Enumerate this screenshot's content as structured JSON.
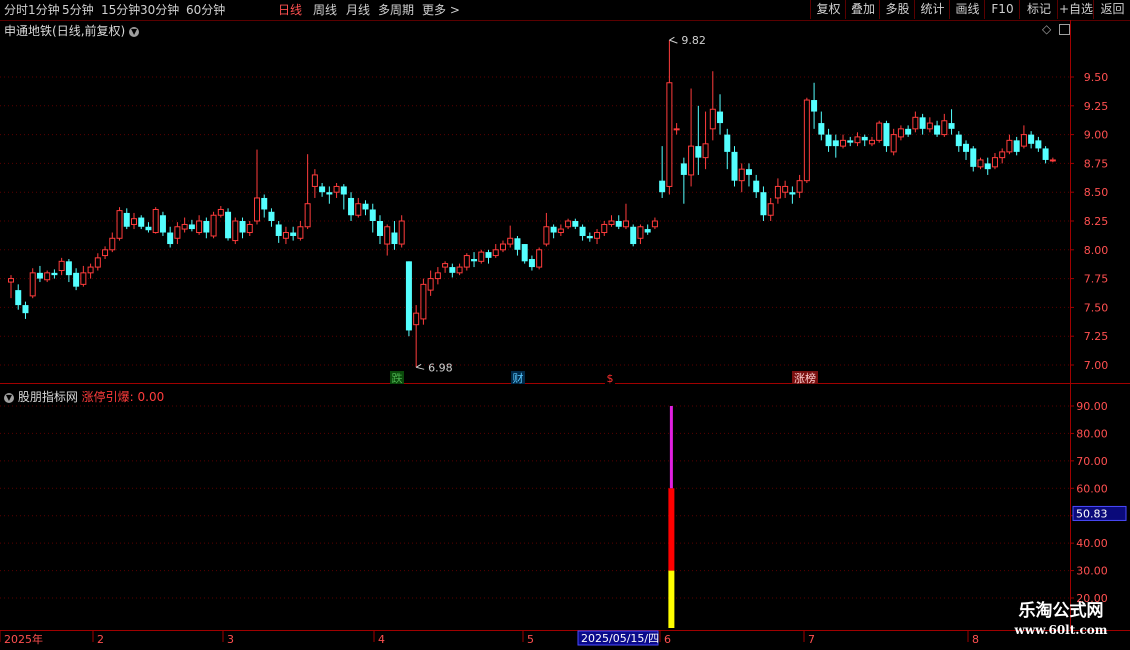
{
  "toolbar": {
    "left_items": [
      "分时",
      "1分钟",
      "5分钟",
      "15分钟",
      "30分钟",
      "60分钟",
      "日线",
      "周线",
      "月线",
      "多周期",
      "更多 >"
    ],
    "active_index": 6,
    "right_items": [
      "复权",
      "叠加",
      "多股",
      "统计",
      "画线",
      "F10",
      "标记",
      "+自选",
      "返回"
    ]
  },
  "main_chart": {
    "stock_name": "申通地铁",
    "period_label": "(日线,前复权)",
    "high_label": "9.82",
    "low_label": "6.98",
    "y_ticks": [
      "9.50",
      "9.25",
      "9.00",
      "8.75",
      "8.50",
      "8.25",
      "8.00",
      "7.75",
      "7.50",
      "7.25",
      "7.00"
    ],
    "markers": [
      {
        "text": "跌",
        "color": "#4caf50",
        "bg": "#0a4a0a"
      },
      {
        "text": "财",
        "color": "#5ac8ff",
        "bg": "#002a4a"
      },
      {
        "text": "$",
        "color": "#ff3030",
        "bg": "#000000"
      },
      {
        "text": "涨榜",
        "color": "#ffd0d0",
        "bg": "#7a1010"
      }
    ]
  },
  "indicator": {
    "name": "股朋指标网",
    "label": "涨停引爆:",
    "value": "0.00",
    "y_ticks": [
      "90.00",
      "80.00",
      "70.00",
      "60.00",
      "50.00",
      "40.00",
      "30.00",
      "20.00"
    ],
    "cursor_value": "50.83",
    "bar": {
      "total": 90,
      "segments": [
        {
          "from": 0,
          "to": 30,
          "color": "#ffff00"
        },
        {
          "from": 30,
          "to": 60,
          "color": "#ff0000"
        },
        {
          "from": 60,
          "to": 90,
          "color": "#e020e0"
        }
      ]
    }
  },
  "time_axis": {
    "labels": [
      "2025年",
      "2",
      "3",
      "4",
      "5",
      "6",
      "7",
      "8"
    ],
    "cursor_date": "2025/05/15/四"
  },
  "watermark": {
    "line1": "乐淘公式网",
    "line2": "www.60lt.com"
  },
  "colors": {
    "up": "#ff3c3c",
    "down": "#54ffff",
    "axis": "#a00000",
    "grid": "#5a0000",
    "tick_text": "#ff5050"
  },
  "chart_data": {
    "type": "candlestick",
    "title": "申通地铁(日线,前复权)",
    "ylim": [
      6.9,
      9.9
    ],
    "candles": [
      [
        7.72,
        7.75,
        7.78,
        7.58
      ],
      [
        7.65,
        7.52,
        7.7,
        7.48
      ],
      [
        7.52,
        7.45,
        7.55,
        7.4
      ],
      [
        7.6,
        7.8,
        7.84,
        7.58
      ],
      [
        7.8,
        7.75,
        7.86,
        7.72
      ],
      [
        7.74,
        7.8,
        7.82,
        7.72
      ],
      [
        7.8,
        7.78,
        7.83,
        7.75
      ],
      [
        7.82,
        7.9,
        7.93,
        7.78
      ],
      [
        7.9,
        7.78,
        7.92,
        7.72
      ],
      [
        7.8,
        7.68,
        7.84,
        7.65
      ],
      [
        7.7,
        7.8,
        7.86,
        7.68
      ],
      [
        7.8,
        7.85,
        7.88,
        7.75
      ],
      [
        7.85,
        7.93,
        7.97,
        7.82
      ],
      [
        7.95,
        8.0,
        8.03,
        7.92
      ],
      [
        8.0,
        8.1,
        8.15,
        7.98
      ],
      [
        8.1,
        8.34,
        8.37,
        8.08
      ],
      [
        8.32,
        8.2,
        8.36,
        8.18
      ],
      [
        8.22,
        8.27,
        8.32,
        8.18
      ],
      [
        8.28,
        8.2,
        8.3,
        8.18
      ],
      [
        8.2,
        8.17,
        8.24,
        8.15
      ],
      [
        8.15,
        8.35,
        8.37,
        8.14
      ],
      [
        8.3,
        8.15,
        8.33,
        8.12
      ],
      [
        8.15,
        8.05,
        8.2,
        8.02
      ],
      [
        8.1,
        8.2,
        8.24,
        8.05
      ],
      [
        8.18,
        8.22,
        8.28,
        8.15
      ],
      [
        8.22,
        8.18,
        8.26,
        8.16
      ],
      [
        8.15,
        8.25,
        8.3,
        8.13
      ],
      [
        8.25,
        8.15,
        8.28,
        8.1
      ],
      [
        8.12,
        8.3,
        8.33,
        8.1
      ],
      [
        8.3,
        8.35,
        8.38,
        8.28
      ],
      [
        8.33,
        8.1,
        8.36,
        8.08
      ],
      [
        8.08,
        8.25,
        8.28,
        8.05
      ],
      [
        8.25,
        8.15,
        8.28,
        8.1
      ],
      [
        8.15,
        8.22,
        8.25,
        8.12
      ],
      [
        8.25,
        8.45,
        8.87,
        8.22
      ],
      [
        8.45,
        8.35,
        8.48,
        8.28
      ],
      [
        8.33,
        8.25,
        8.36,
        8.2
      ],
      [
        8.22,
        8.12,
        8.25,
        8.06
      ],
      [
        8.1,
        8.15,
        8.2,
        8.05
      ],
      [
        8.15,
        8.12,
        8.2,
        8.08
      ],
      [
        8.1,
        8.2,
        8.25,
        8.08
      ],
      [
        8.2,
        8.4,
        8.83,
        8.18
      ],
      [
        8.55,
        8.65,
        8.7,
        8.45
      ],
      [
        8.55,
        8.5,
        8.58,
        8.46
      ],
      [
        8.5,
        8.48,
        8.55,
        8.4
      ],
      [
        8.5,
        8.55,
        8.58,
        8.45
      ],
      [
        8.55,
        8.48,
        8.57,
        8.35
      ],
      [
        8.45,
        8.3,
        8.5,
        8.25
      ],
      [
        8.3,
        8.4,
        8.45,
        8.28
      ],
      [
        8.4,
        8.35,
        8.43,
        8.3
      ],
      [
        8.35,
        8.25,
        8.4,
        8.15
      ],
      [
        8.25,
        8.12,
        8.3,
        8.05
      ],
      [
        8.05,
        8.2,
        8.22,
        7.95
      ],
      [
        8.15,
        8.05,
        8.25,
        8.0
      ],
      [
        8.05,
        8.25,
        8.3,
        8.02
      ],
      [
        7.9,
        7.3,
        7.9,
        7.25
      ],
      [
        7.35,
        7.45,
        7.52,
        6.98
      ],
      [
        7.4,
        7.7,
        7.75,
        7.35
      ],
      [
        7.65,
        7.75,
        7.82,
        7.6
      ],
      [
        7.75,
        7.8,
        7.85,
        7.7
      ],
      [
        7.85,
        7.88,
        7.9,
        7.8
      ],
      [
        7.85,
        7.8,
        7.88,
        7.76
      ],
      [
        7.8,
        7.85,
        7.88,
        7.78
      ],
      [
        7.85,
        7.95,
        7.97,
        7.82
      ],
      [
        7.92,
        7.9,
        7.98,
        7.85
      ],
      [
        7.9,
        7.98,
        8.0,
        7.88
      ],
      [
        7.98,
        7.93,
        8.0,
        7.88
      ],
      [
        7.95,
        8.0,
        8.05,
        7.93
      ],
      [
        8.0,
        8.05,
        8.08,
        7.98
      ],
      [
        8.05,
        8.1,
        8.21,
        8.02
      ],
      [
        8.1,
        8.0,
        8.12,
        7.95
      ],
      [
        8.05,
        7.9,
        8.05,
        7.88
      ],
      [
        7.92,
        7.85,
        7.95,
        7.82
      ],
      [
        7.85,
        8.0,
        8.02,
        7.83
      ],
      [
        8.05,
        8.2,
        8.32,
        8.03
      ],
      [
        8.2,
        8.15,
        8.22,
        8.1
      ],
      [
        8.15,
        8.18,
        8.22,
        8.12
      ],
      [
        8.2,
        8.25,
        8.27,
        8.18
      ],
      [
        8.25,
        8.2,
        8.27,
        8.18
      ],
      [
        8.2,
        8.12,
        8.22,
        8.08
      ],
      [
        8.12,
        8.1,
        8.15,
        8.07
      ],
      [
        8.1,
        8.15,
        8.18,
        8.05
      ],
      [
        8.15,
        8.22,
        8.25,
        8.12
      ],
      [
        8.22,
        8.25,
        8.3,
        8.2
      ],
      [
        8.25,
        8.2,
        8.3,
        8.18
      ],
      [
        8.2,
        8.25,
        8.4,
        8.18
      ],
      [
        8.2,
        8.05,
        8.22,
        8.03
      ],
      [
        8.1,
        8.2,
        8.22,
        8.05
      ],
      [
        8.18,
        8.15,
        8.22,
        8.13
      ],
      [
        8.2,
        8.25,
        8.28,
        8.18
      ],
      [
        8.6,
        8.5,
        8.9,
        8.45
      ],
      [
        8.55,
        9.45,
        9.82,
        8.48
      ],
      [
        9.05,
        9.05,
        9.1,
        9.0
      ],
      [
        8.75,
        8.65,
        8.8,
        8.4
      ],
      [
        8.65,
        8.9,
        9.4,
        8.55
      ],
      [
        8.9,
        8.8,
        9.25,
        8.65
      ],
      [
        8.8,
        8.92,
        9.2,
        8.7
      ],
      [
        9.05,
        9.22,
        9.55,
        8.95
      ],
      [
        9.2,
        9.1,
        9.35,
        9.0
      ],
      [
        9.0,
        8.85,
        9.05,
        8.7
      ],
      [
        8.85,
        8.6,
        8.9,
        8.55
      ],
      [
        8.6,
        8.7,
        8.75,
        8.5
      ],
      [
        8.7,
        8.65,
        8.75,
        8.55
      ],
      [
        8.6,
        8.5,
        8.65,
        8.45
      ],
      [
        8.5,
        8.3,
        8.55,
        8.25
      ],
      [
        8.3,
        8.4,
        8.45,
        8.25
      ],
      [
        8.45,
        8.55,
        8.62,
        8.4
      ],
      [
        8.5,
        8.55,
        8.6,
        8.45
      ],
      [
        8.5,
        8.48,
        8.55,
        8.4
      ],
      [
        8.5,
        8.6,
        8.65,
        8.45
      ],
      [
        8.6,
        9.3,
        9.32,
        8.58
      ],
      [
        9.3,
        9.2,
        9.45,
        9.05
      ],
      [
        9.1,
        9.0,
        9.2,
        8.95
      ],
      [
        9.0,
        8.9,
        9.05,
        8.85
      ],
      [
        8.95,
        8.9,
        9.0,
        8.8
      ],
      [
        8.9,
        8.95,
        9.0,
        8.88
      ],
      [
        8.95,
        8.93,
        8.98,
        8.9
      ],
      [
        8.93,
        8.98,
        9.02,
        8.9
      ],
      [
        8.98,
        8.95,
        9.0,
        8.9
      ],
      [
        8.92,
        8.95,
        8.98,
        8.9
      ],
      [
        8.95,
        9.1,
        9.12,
        8.93
      ],
      [
        9.1,
        8.9,
        9.12,
        8.85
      ],
      [
        8.85,
        9.0,
        9.05,
        8.82
      ],
      [
        8.98,
        9.05,
        9.08,
        8.95
      ],
      [
        9.05,
        9.0,
        9.08,
        8.98
      ],
      [
        9.05,
        9.15,
        9.2,
        9.02
      ],
      [
        9.15,
        9.05,
        9.18,
        9.0
      ],
      [
        9.05,
        9.1,
        9.15,
        9.02
      ],
      [
        9.08,
        9.0,
        9.12,
        8.98
      ],
      [
        9.0,
        9.12,
        9.18,
        8.98
      ],
      [
        9.1,
        9.05,
        9.22,
        9.0
      ],
      [
        9.0,
        8.9,
        9.03,
        8.85
      ],
      [
        8.92,
        8.85,
        8.95,
        8.78
      ],
      [
        8.88,
        8.72,
        8.9,
        8.68
      ],
      [
        8.72,
        8.78,
        8.8,
        8.7
      ],
      [
        8.75,
        8.7,
        8.8,
        8.65
      ],
      [
        8.72,
        8.8,
        8.84,
        8.7
      ],
      [
        8.8,
        8.85,
        8.88,
        8.75
      ],
      [
        8.85,
        8.95,
        9.0,
        8.83
      ],
      [
        8.95,
        8.85,
        8.98,
        8.82
      ],
      [
        8.9,
        9.0,
        9.08,
        8.88
      ],
      [
        9.0,
        8.92,
        9.03,
        8.88
      ],
      [
        8.95,
        8.88,
        8.98,
        8.85
      ],
      [
        8.88,
        8.78,
        8.9,
        8.75
      ],
      [
        8.78,
        8.78,
        8.8,
        8.76
      ]
    ],
    "cursor_index": 91
  }
}
